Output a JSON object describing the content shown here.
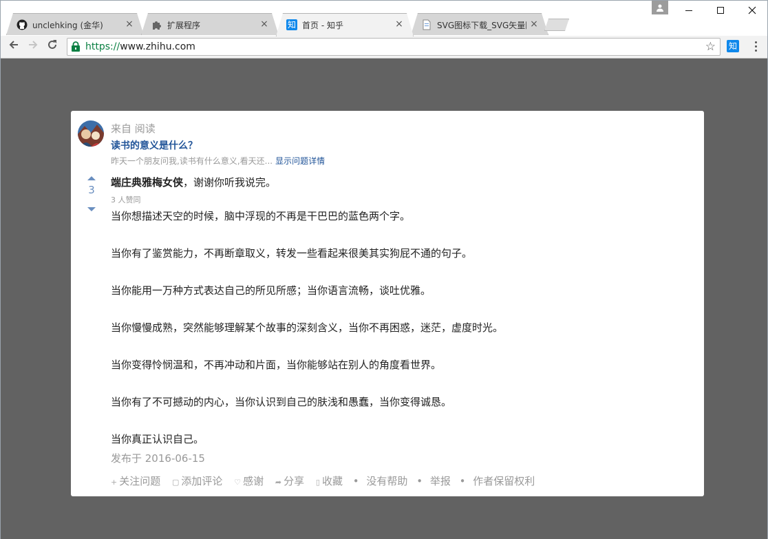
{
  "browser": {
    "tabs": [
      {
        "title": "unclehking (金华)",
        "icon": "github-icon"
      },
      {
        "title": "扩展程序",
        "icon": "puzzle-icon"
      },
      {
        "title": "首页 - 知乎",
        "icon": "zhihu-icon",
        "favicon_text": "知"
      },
      {
        "title": "SVG图标下载_SVG矢量图",
        "icon": "document-icon"
      }
    ],
    "url_scheme": "https://",
    "url_host": "www.zhihu.com",
    "extension_text": "知",
    "accent": "#0f88eb"
  },
  "card": {
    "source_label": "来自 阅读",
    "question": "读书的意义是什么？",
    "excerpt": "昨天一个朋友问我,读书有什么意义,看天还...",
    "excerpt_link": "显示问题详情",
    "vote_count": "3",
    "author_name": "端庄典雅梅女侠",
    "author_bio": "，谢谢你听我说完。",
    "likes": "3 人赞同",
    "paragraphs": [
      "当你想描述天空的时候，脑中浮现的不再是干巴巴的蓝色两个字。",
      "当你有了鉴赏能力，不再断章取义，转发一些看起来很美其实狗屁不通的句子。",
      "当你能用一万种方式表达自己的所见所感；当你语言流畅，谈吐优雅。",
      "当你慢慢成熟，突然能够理解某个故事的深刻含义，当你不再困惑，迷茫，虚度时光。",
      "当你变得怜悯温和，不再冲动和片面，当你能够站在别人的角度看世界。",
      "当你有了不可撼动的内心，当你认识到自己的肤浅和愚蠢，当你变得诚恳。",
      "当你真正认识自己。"
    ],
    "date": "发布于 2016-06-15",
    "actions": {
      "follow": "关注问题",
      "comment": "添加评论",
      "thanks": "感谢",
      "share": "分享",
      "collect": "收藏",
      "unhelpful": "没有帮助",
      "report": "举报",
      "copyright": "作者保留权利"
    }
  }
}
